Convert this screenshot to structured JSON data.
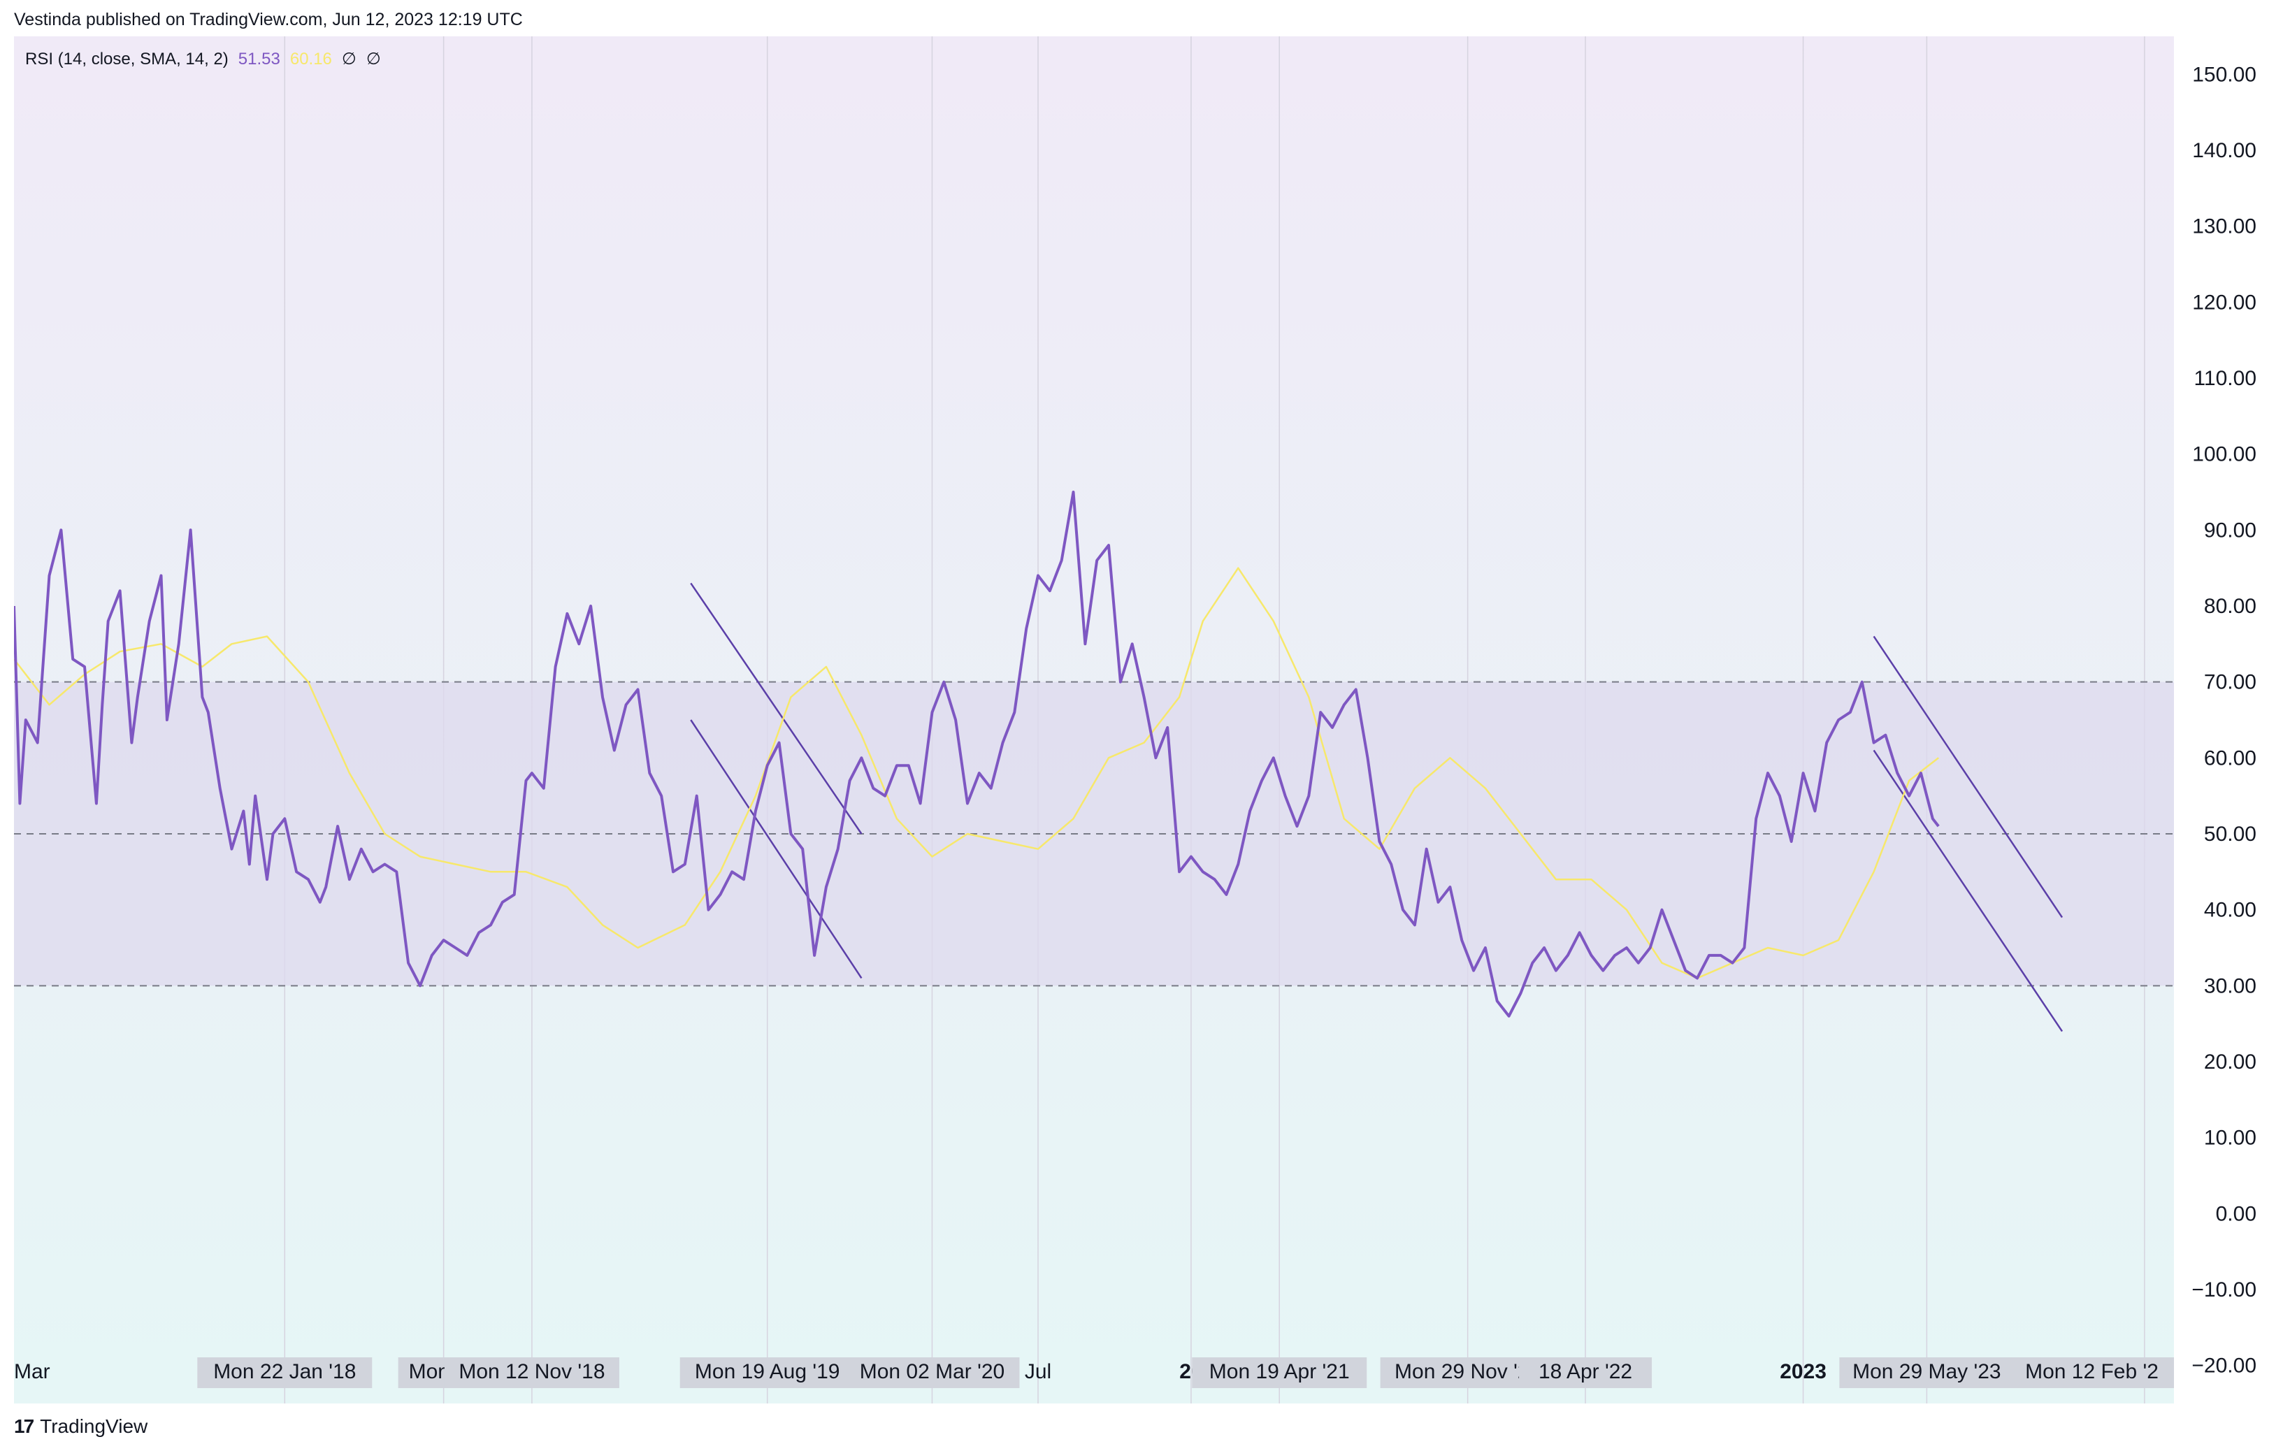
{
  "header": {
    "publisher_line": "Vestinda published on TradingView.com, Jun 12, 2023 12:19 UTC"
  },
  "legend": {
    "indicator": "RSI (14, close, SMA, 14, 2)",
    "rsi_value": "51.53",
    "ma_value": "60.16",
    "na1": "∅",
    "na2": "∅"
  },
  "footer": {
    "brand": "TradingView",
    "brand_mark": "17"
  },
  "colors": {
    "rsi_line": "#7e57c2",
    "ma_line": "#f7e86b",
    "band_fill": "#ddd9ee",
    "trendline": "#5b3fa8",
    "bg_top": "#f0eaf7",
    "bg_bottom": "#e6f6f6",
    "label_box": "#d1d4dc"
  },
  "chart_data": {
    "type": "line",
    "title": "",
    "ylim": [
      -25,
      155
    ],
    "y_ticks": [
      "150.00",
      "140.00",
      "130.00",
      "120.00",
      "110.00",
      "100.00",
      "90.00",
      "80.00",
      "70.00",
      "60.00",
      "50.00",
      "40.00",
      "30.00",
      "20.00",
      "10.00",
      "0.00",
      "−10.00",
      "−20.00"
    ],
    "y_tick_values": [
      150,
      140,
      130,
      120,
      110,
      100,
      90,
      80,
      70,
      60,
      50,
      40,
      30,
      20,
      10,
      0,
      -10,
      -20
    ],
    "x_range": [
      "2017-03-06",
      "2024-03-18"
    ],
    "levels": [
      70,
      50,
      30
    ],
    "x_ticks": [
      {
        "label": "Mar",
        "date": "2017-03-06",
        "box": false,
        "bold": false
      },
      {
        "label": "Mon 22 Jan '18",
        "date": "2018-01-22",
        "box": true,
        "bold": false
      },
      {
        "label": "Mon 30",
        "date": "2018-07-30",
        "box": true,
        "bold": false
      },
      {
        "label": "Mon 12 Nov '18",
        "date": "2018-11-12",
        "box": true,
        "bold": false
      },
      {
        "label": "Mon 19 Aug '19",
        "date": "2019-08-19",
        "box": true,
        "bold": false
      },
      {
        "label": "Mon 02 Mar '20",
        "date": "2020-03-02",
        "box": true,
        "bold": false
      },
      {
        "label": "Jul",
        "date": "2020-07-06",
        "box": false,
        "bold": false
      },
      {
        "label": "20",
        "date": "2021-01-04",
        "box": false,
        "bold": true
      },
      {
        "label": "Mon 19 Apr '21",
        "date": "2021-04-19",
        "box": true,
        "bold": false
      },
      {
        "label": "Mon 29 Nov '21",
        "date": "2021-11-29",
        "box": true,
        "bold": false
      },
      {
        "label": "18 Apr '22",
        "date": "2022-04-18",
        "box": true,
        "bold": false
      },
      {
        "label": "2023",
        "date": "2023-01-02",
        "box": false,
        "bold": true
      },
      {
        "label": "Mon 29 May '23",
        "date": "2023-05-29",
        "box": true,
        "bold": false
      },
      {
        "label": "Mon 12 Feb '2",
        "date": "2024-02-12",
        "box": true,
        "bold": false
      }
    ],
    "series": [
      {
        "name": "RSI",
        "x": [
          "2017-03-06",
          "2017-03-13",
          "2017-03-20",
          "2017-04-03",
          "2017-04-17",
          "2017-05-01",
          "2017-05-15",
          "2017-05-29",
          "2017-06-12",
          "2017-06-19",
          "2017-06-26",
          "2017-07-10",
          "2017-07-24",
          "2017-07-31",
          "2017-08-14",
          "2017-08-28",
          "2017-09-04",
          "2017-09-18",
          "2017-10-02",
          "2017-10-16",
          "2017-10-23",
          "2017-11-06",
          "2017-11-20",
          "2017-12-04",
          "2017-12-11",
          "2017-12-18",
          "2018-01-01",
          "2018-01-08",
          "2018-01-22",
          "2018-02-05",
          "2018-02-19",
          "2018-03-05",
          "2018-03-12",
          "2018-03-26",
          "2018-04-09",
          "2018-04-23",
          "2018-05-07",
          "2018-05-21",
          "2018-06-04",
          "2018-06-18",
          "2018-07-02",
          "2018-07-16",
          "2018-07-30",
          "2018-08-13",
          "2018-08-27",
          "2018-09-10",
          "2018-09-24",
          "2018-10-08",
          "2018-10-22",
          "2018-11-05",
          "2018-11-12",
          "2018-11-26",
          "2018-12-10",
          "2018-12-24",
          "2019-01-07",
          "2019-01-21",
          "2019-02-04",
          "2019-02-18",
          "2019-03-04",
          "2019-03-18",
          "2019-04-01",
          "2019-04-15",
          "2019-04-29",
          "2019-05-13",
          "2019-05-27",
          "2019-06-10",
          "2019-06-24",
          "2019-07-08",
          "2019-07-22",
          "2019-08-05",
          "2019-08-19",
          "2019-09-02",
          "2019-09-16",
          "2019-09-30",
          "2019-10-14",
          "2019-10-28",
          "2019-11-11",
          "2019-11-25",
          "2019-12-09",
          "2019-12-23",
          "2020-01-06",
          "2020-01-20",
          "2020-02-03",
          "2020-02-17",
          "2020-03-02",
          "2020-03-16",
          "2020-03-30",
          "2020-04-13",
          "2020-04-27",
          "2020-05-11",
          "2020-05-25",
          "2020-06-08",
          "2020-06-22",
          "2020-07-06",
          "2020-07-20",
          "2020-08-03",
          "2020-08-17",
          "2020-08-31",
          "2020-09-14",
          "2020-09-28",
          "2020-10-12",
          "2020-10-26",
          "2020-11-09",
          "2020-11-23",
          "2020-12-07",
          "2020-12-21",
          "2021-01-04",
          "2021-01-18",
          "2021-02-01",
          "2021-02-15",
          "2021-03-01",
          "2021-03-15",
          "2021-03-29",
          "2021-04-12",
          "2021-04-26",
          "2021-05-10",
          "2021-05-24",
          "2021-06-07",
          "2021-06-21",
          "2021-07-05",
          "2021-07-19",
          "2021-08-02",
          "2021-08-16",
          "2021-08-30",
          "2021-09-13",
          "2021-09-27",
          "2021-10-11",
          "2021-10-25",
          "2021-11-08",
          "2021-11-22",
          "2021-12-06",
          "2021-12-20",
          "2022-01-03",
          "2022-01-17",
          "2022-01-31",
          "2022-02-14",
          "2022-02-28",
          "2022-03-14",
          "2022-03-28",
          "2022-04-11",
          "2022-04-25",
          "2022-05-09",
          "2022-05-23",
          "2022-06-06",
          "2022-06-20",
          "2022-07-04",
          "2022-07-18",
          "2022-08-01",
          "2022-08-15",
          "2022-08-29",
          "2022-09-12",
          "2022-09-26",
          "2022-10-10",
          "2022-10-24",
          "2022-11-07",
          "2022-11-21",
          "2022-12-05",
          "2022-12-19",
          "2023-01-02",
          "2023-01-16",
          "2023-01-30",
          "2023-02-13",
          "2023-02-27",
          "2023-03-13",
          "2023-03-27",
          "2023-04-10",
          "2023-04-24",
          "2023-05-08",
          "2023-05-22",
          "2023-06-05",
          "2023-06-12"
        ],
        "values": [
          80,
          54,
          65,
          62,
          84,
          90,
          73,
          72,
          54,
          67,
          78,
          82,
          62,
          68,
          78,
          84,
          65,
          75,
          90,
          68,
          66,
          56,
          48,
          53,
          46,
          55,
          44,
          50,
          52,
          45,
          44,
          41,
          43,
          51,
          44,
          48,
          45,
          46,
          45,
          33,
          30,
          34,
          36,
          35,
          34,
          37,
          38,
          41,
          42,
          57,
          58,
          56,
          72,
          79,
          75,
          80,
          68,
          61,
          67,
          69,
          58,
          55,
          45,
          46,
          55,
          40,
          42,
          45,
          44,
          53,
          59,
          62,
          50,
          48,
          34,
          43,
          48,
          57,
          60,
          56,
          55,
          59,
          59,
          54,
          66,
          70,
          65,
          54,
          58,
          56,
          62,
          66,
          77,
          84,
          82,
          86,
          95,
          75,
          86,
          88,
          70,
          75,
          68,
          60,
          64,
          45,
          47,
          45,
          44,
          42,
          46,
          53,
          57,
          60,
          55,
          51,
          55,
          66,
          64,
          67,
          69,
          60,
          49,
          46,
          40,
          38,
          48,
          41,
          43,
          36,
          32,
          35,
          28,
          26,
          29,
          33,
          35,
          32,
          34,
          37,
          34,
          32,
          34,
          35,
          33,
          35,
          40,
          36,
          32,
          31,
          34,
          34,
          33,
          35,
          52,
          58,
          55,
          49,
          58,
          53,
          62,
          65,
          66,
          70,
          62,
          63,
          58,
          55,
          58,
          52,
          51
        ],
        "color": "#7e57c2"
      },
      {
        "name": "MA",
        "x": [
          "2017-03-06",
          "2017-04-17",
          "2017-05-29",
          "2017-07-10",
          "2017-08-28",
          "2017-10-16",
          "2017-11-20",
          "2018-01-01",
          "2018-02-19",
          "2018-04-09",
          "2018-05-21",
          "2018-07-02",
          "2018-08-13",
          "2018-09-24",
          "2018-11-05",
          "2018-12-24",
          "2019-02-04",
          "2019-03-18",
          "2019-05-13",
          "2019-06-24",
          "2019-08-05",
          "2019-09-16",
          "2019-10-28",
          "2019-12-09",
          "2020-01-20",
          "2020-03-02",
          "2020-04-13",
          "2020-05-25",
          "2020-07-06",
          "2020-08-17",
          "2020-09-28",
          "2020-11-09",
          "2020-12-21",
          "2021-01-18",
          "2021-03-01",
          "2021-04-12",
          "2021-05-24",
          "2021-07-05",
          "2021-08-16",
          "2021-09-27",
          "2021-11-08",
          "2021-12-20",
          "2022-01-31",
          "2022-03-14",
          "2022-04-25",
          "2022-06-06",
          "2022-07-18",
          "2022-08-29",
          "2022-10-10",
          "2022-11-21",
          "2023-01-02",
          "2023-02-13",
          "2023-03-27",
          "2023-05-08",
          "2023-06-12"
        ],
        "values": [
          73,
          67,
          71,
          74,
          75,
          72,
          75,
          76,
          70,
          58,
          50,
          47,
          46,
          45,
          45,
          43,
          38,
          35,
          38,
          45,
          55,
          68,
          72,
          63,
          52,
          47,
          50,
          49,
          48,
          52,
          60,
          62,
          68,
          78,
          85,
          78,
          68,
          52,
          48,
          56,
          60,
          56,
          50,
          44,
          44,
          40,
          33,
          31,
          33,
          35,
          34,
          36,
          45,
          57,
          60
        ],
        "color": "#f7e86b"
      }
    ],
    "trendlines": [
      {
        "x1": "2019-05-20",
        "y1": 83,
        "x2": "2019-12-09",
        "y2": 50
      },
      {
        "x1": "2019-05-20",
        "y1": 65,
        "x2": "2019-12-09",
        "y2": 31
      },
      {
        "x1": "2023-03-27",
        "y1": 76,
        "x2": "2023-11-06",
        "y2": 39
      },
      {
        "x1": "2023-03-27",
        "y1": 61,
        "x2": "2023-11-06",
        "y2": 24
      }
    ]
  }
}
